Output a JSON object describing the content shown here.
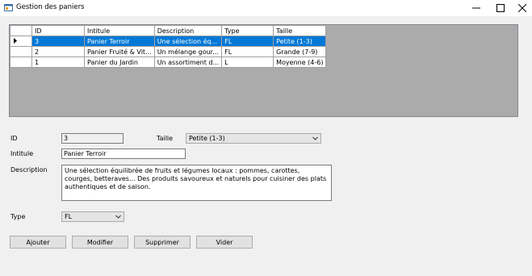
{
  "window": {
    "title": "Gestion des paniers",
    "icon": "app-window-icon",
    "minimize_icon": "minimize-icon",
    "maximize_icon": "maximize-icon",
    "close_icon": "close-icon"
  },
  "grid": {
    "columns": [
      "ID",
      "Intitule",
      "Description",
      "Type",
      "Taille"
    ],
    "row_pointer_icon": "current-row-arrow-icon",
    "rows": [
      {
        "id": "3",
        "intitule": "Panier Terroir",
        "description": "Une sélection éq...",
        "type": "FL",
        "taille": "Petite (1-3)",
        "selected": true
      },
      {
        "id": "2",
        "intitule": "Panier Fruité & Vit...",
        "description": "Un mélange gour...",
        "type": "FL",
        "taille": "Grande (7-9)",
        "selected": false
      },
      {
        "id": "1",
        "intitule": "Panier du Jardin",
        "description": "Un assortiment d...",
        "type": "L",
        "taille": "Moyenne (4-6)",
        "selected": false
      }
    ]
  },
  "form": {
    "id_label": "ID",
    "id_value": "3",
    "taille_label": "Taille",
    "taille_value": "Petite (1-3)",
    "intitule_label": "Intitule",
    "intitule_value": "Panier Terroir",
    "description_label": "Description",
    "description_value": "Une sélection équilibrée de fruits et légumes locaux : pommes, carottes, courges, betteraves... Des produits savoureux et naturels pour cuisiner des plats authentiques et de saison.",
    "type_label": "Type",
    "type_value": "FL"
  },
  "buttons": {
    "ajouter": "Ajouter",
    "modifier": "Modifier",
    "supprimer": "Supprimer",
    "vider": "Vider"
  },
  "colors": {
    "selection": "#0078d7",
    "grid_background": "#ababab",
    "window_background": "#f0f0f0"
  }
}
